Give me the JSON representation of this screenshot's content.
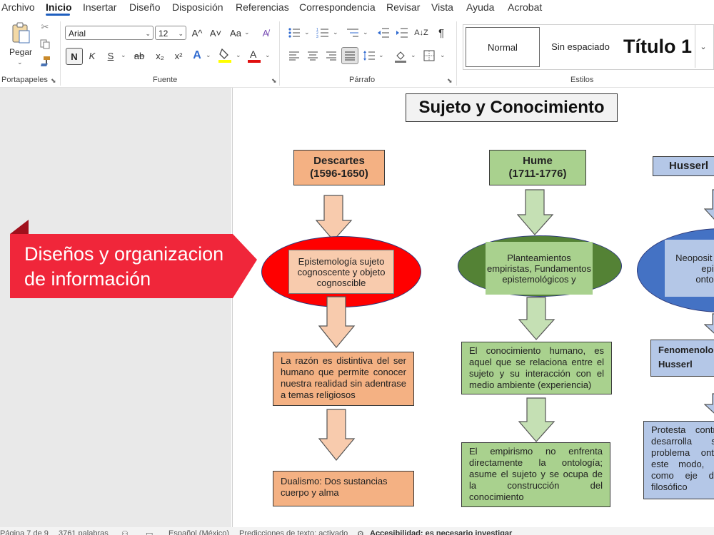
{
  "menu": {
    "items": [
      "Archivo",
      "Inicio",
      "Insertar",
      "Diseño",
      "Disposición",
      "Referencias",
      "Correspondencia",
      "Revisar",
      "Vista",
      "Ayuda",
      "Acrobat"
    ],
    "active": "Inicio"
  },
  "ribbon": {
    "clipboard": {
      "paste_label": "Pegar",
      "group_label": "Portapapeles"
    },
    "font": {
      "group_label": "Fuente",
      "font_name": "Arial",
      "font_size": "12",
      "grow": "A^",
      "shrink": "A˅",
      "case": "Aa",
      "bold": "N",
      "italic": "K",
      "underline": "S",
      "strike": "ab",
      "subscript": "x₂",
      "superscript": "x²",
      "text_effects": "A",
      "highlight_color": "#ffff00",
      "font_color": "#e01010"
    },
    "paragraph": {
      "group_label": "Párrafo",
      "pilcrow": "¶"
    },
    "styles": {
      "group_label": "Estilos",
      "items": [
        "Normal",
        "Sin espaciado",
        "Título 1"
      ]
    }
  },
  "document": {
    "title": "Sujeto y Conocimiento",
    "banner": {
      "line1": "Diseños y organizacion",
      "line2": "de información",
      "color": "#f0263a"
    },
    "columns": [
      {
        "name": "Descartes",
        "years": "(1596-1650)",
        "header_color": "#f4b183",
        "oval_color": "#ff0000",
        "oval_text": "Epistemología sujeto cognoscente y objeto cognoscible",
        "box1": "La razón es distintiva del ser humano que permite conocer nuestra realidad sin adentrase a temas religiosos",
        "box2": "Dualismo: Dos sustancias cuerpo y alma"
      },
      {
        "name": "Hume",
        "years": "(1711-1776)",
        "header_color": "#a9d18e",
        "oval_color": "#548235",
        "oval_text": "Planteamientos empiristas, Fundamentos epistemológicos y",
        "box1": "El conocimiento humano, es aquel que se relaciona entre el sujeto y su interacción con el medio ambiente (experiencia)",
        "box2": "El empirismo no enfrenta directamente la ontología; asume el sujeto y se ocupa de la construcción del conocimiento"
      },
      {
        "name": "Husserl",
        "header_color": "#b4c7e7",
        "oval_color": "#4472c4",
        "oval_text": "Neoposit Po episte ontológ",
        "box1_line1": "Fenomenolo",
        "box1_line2": "Husserl",
        "box2": "Protesta contra desarrolla so problema ontol este modo, la como eje del filosófico"
      }
    ]
  },
  "status": {
    "page": "Página 7 de 9",
    "words": "3761 palabras",
    "language": "Español (México)",
    "predictions": "Predicciones de texto: activado",
    "accessibility": "Accesibilidad: es necesario investigar"
  }
}
